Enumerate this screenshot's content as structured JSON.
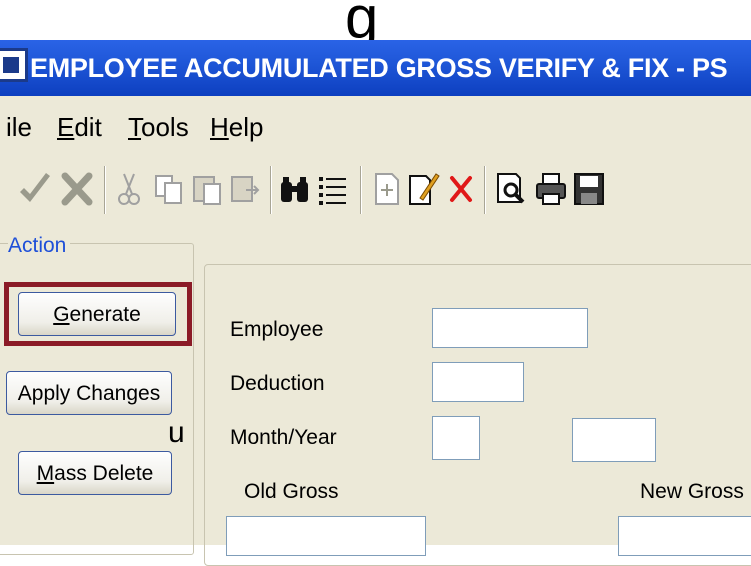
{
  "window": {
    "title": "EMPLOYEE ACCUMULATED GROSS VERIFY & FIX - PS"
  },
  "menu": {
    "file": "ile",
    "edit_first": "E",
    "edit_rest": "dit",
    "tools_first": "T",
    "tools_rest": "ools",
    "help_first": "H",
    "help_rest": "elp"
  },
  "toolbar": {
    "icons": [
      "check-icon",
      "cancel-icon",
      "cut-icon",
      "copy-icon",
      "paste-icon",
      "paste-special-icon",
      "find-icon",
      "list-icon",
      "new-record-icon",
      "edit-record-icon",
      "delete-icon",
      "print-preview-icon",
      "print-icon",
      "save-icon"
    ]
  },
  "action": {
    "group_label": "Action",
    "generate_first": "G",
    "generate_rest": "enerate",
    "apply_changes": "Apply Changes",
    "mass_first": "M",
    "mass_rest": "ass Delete"
  },
  "stray_text": "u",
  "form": {
    "employee_label": "Employee",
    "deduction_label": "Deduction",
    "month_year_label": "Month/Year",
    "old_gross_label": "Old Gross",
    "new_gross_label": "New Gross"
  },
  "colors": {
    "title_bar": "#1f57d8",
    "highlight_border": "#8b1b27",
    "group_label": "#1e4fd8"
  }
}
